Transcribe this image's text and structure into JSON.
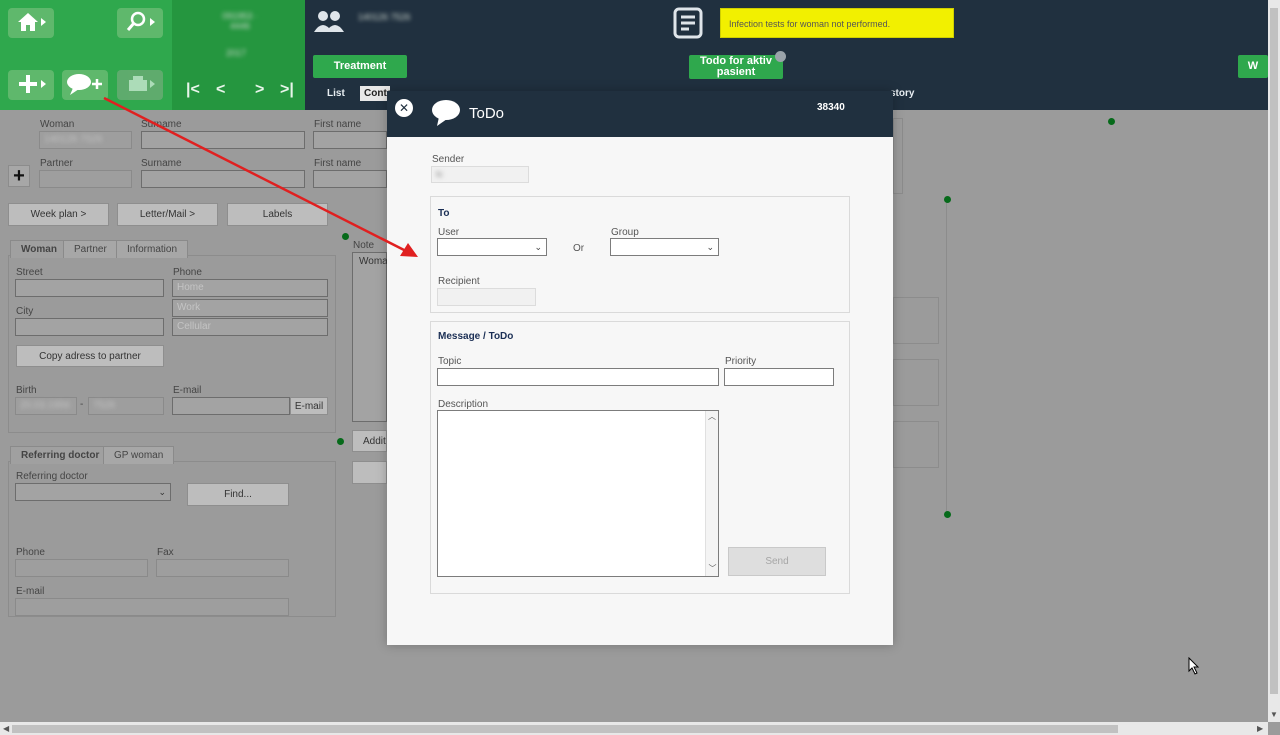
{
  "topbar": {
    "id_blurred": "091953 · 4446",
    "date_blurred": "2017",
    "patient_id_blurred": "140126 7526",
    "treatment_button": "Treatment",
    "todo_button": "Todo for aktiv pasient",
    "right_button": "W",
    "alert_text": "Infection tests for woman not performed.",
    "tabs": {
      "list": "List",
      "contact": "Conta",
      "history": "story"
    }
  },
  "icons": {
    "home": "home-icon",
    "search": "search-icon",
    "add": "add-icon",
    "add_todo": "speech-bubble-add-icon",
    "print": "printer-icon",
    "people": "people-icon",
    "document": "document-icon"
  },
  "form": {
    "woman_label": "Woman",
    "woman_value_blurred": "140126 7526",
    "surname_label": "Surname",
    "firstname_label": "First name",
    "partner_label": "Partner",
    "surname2_label": "Surname",
    "firstname2_label": "First name",
    "week_plan": "Week plan >",
    "letter_mail": "Letter/Mail >",
    "labels": "Labels",
    "tabs": [
      "Woman",
      "Partner",
      "Information"
    ],
    "street_label": "Street",
    "phone_label": "Phone",
    "phone_home": "Home",
    "phone_work": "Work",
    "phone_cell": "Cellular",
    "city_label": "City",
    "copy_address": "Copy adress to partner",
    "birth_label": "Birth",
    "birth_date_blurred": "20.03.1956",
    "birth_dash": "-",
    "birth_num_blurred": "7526",
    "email_label": "E-mail",
    "email_button": "E-mail",
    "note_label": "Note",
    "note_value": "Woma",
    "additional": "Addit",
    "ref_tabs": [
      "Referring doctor",
      "GP woman"
    ],
    "referring_doctor_label": "Referring doctor",
    "find_button": "Find...",
    "ref_phone_label": "Phone",
    "ref_fax_label": "Fax",
    "ref_email_label": "E-mail"
  },
  "modal": {
    "title": "ToDo",
    "id": "38340",
    "sender_label": "Sender",
    "sender_value_blurred": "tc",
    "to_heading": "To",
    "user_label": "User",
    "or_label": "Or",
    "group_label": "Group",
    "recipient_label": "Recipient",
    "message_heading": "Message  / ToDo",
    "topic_label": "Topic",
    "priority_label": "Priority",
    "description_label": "Description",
    "send_button": "Send"
  },
  "colors": {
    "green": "#2fa84d",
    "navy": "#20303f",
    "alert_yellow": "#f2f000",
    "arrow_red": "#e02020"
  }
}
